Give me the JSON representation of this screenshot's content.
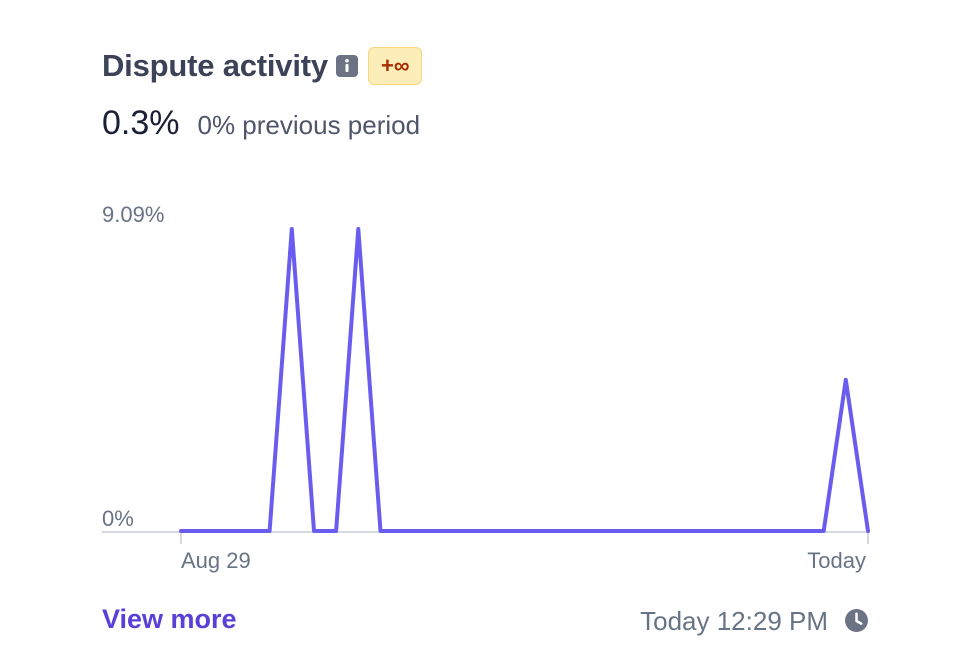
{
  "header": {
    "title": "Dispute activity",
    "info_icon": "info-icon",
    "badge": "+∞"
  },
  "metric": {
    "value": "0.3%",
    "previous": "0% previous period"
  },
  "chart_data": {
    "type": "line",
    "x": [
      "Aug 29",
      "",
      "",
      "",
      "",
      "",
      "",
      "",
      "",
      "",
      "",
      "",
      "",
      "",
      "",
      "",
      "",
      "",
      "",
      "",
      "",
      "",
      "",
      "",
      "",
      "",
      "",
      "",
      "",
      "",
      "Today"
    ],
    "series": [
      {
        "values": [
          0,
          0,
          0,
          0,
          0,
          9.09,
          0,
          0,
          9.09,
          0,
          0,
          0,
          0,
          0,
          0,
          0,
          0,
          0,
          0,
          0,
          0,
          0,
          0,
          0,
          0,
          0,
          0,
          0,
          0,
          0,
          4.55,
          0
        ]
      }
    ],
    "ylim": [
      0,
      9.09
    ],
    "y_ticks": [
      "9.09%",
      "0%"
    ],
    "x_ticks": [
      "Aug 29",
      "Today"
    ],
    "line_color": "#6b5cf0"
  },
  "footer": {
    "view_more": "View more",
    "timestamp": "Today 12:29 PM",
    "clock_icon": "clock-icon"
  },
  "colors": {
    "title": "#3c4257",
    "link": "#5b3fd6",
    "badge_bg": "#fcedb9",
    "badge_text": "#a82c00"
  }
}
